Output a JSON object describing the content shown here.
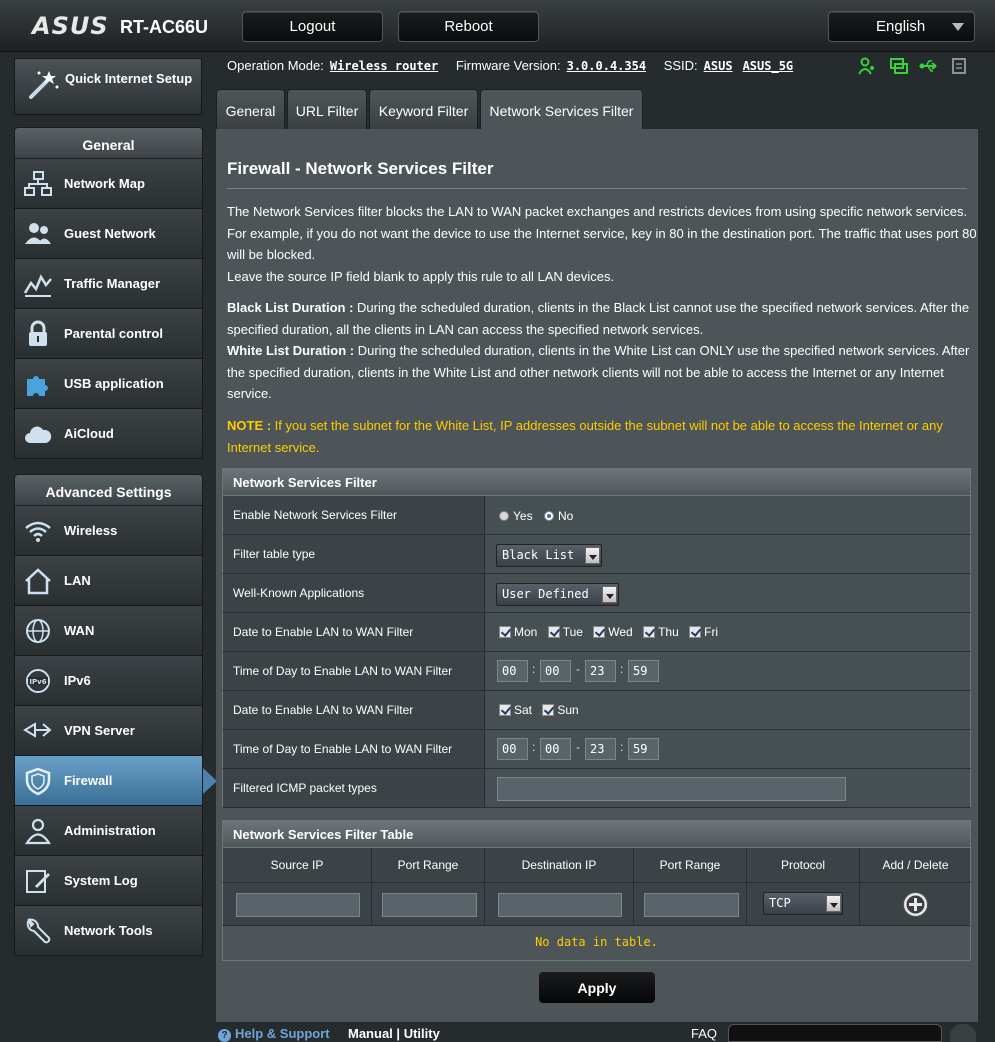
{
  "header": {
    "brand": "ASUS",
    "model": "RT-AC66U",
    "logout_label": "Logout",
    "reboot_label": "Reboot",
    "language": "English"
  },
  "status": {
    "operation_mode_label": "Operation Mode:",
    "operation_mode_value": "Wireless router",
    "firmware_label": "Firmware Version:",
    "firmware_value": "3.0.0.4.354",
    "ssid_label": "SSID:",
    "ssid_1": "ASUS",
    "ssid_2": "ASUS_5G",
    "icons": [
      "clients-icon",
      "network-status-icon",
      "usb-icon",
      "printer-icon"
    ],
    "icon_color": "#39d139"
  },
  "sidebar": {
    "qis_label": "Quick Internet Setup",
    "general_title": "General",
    "general_items": [
      {
        "label": "Network Map",
        "icon": "network-map-icon"
      },
      {
        "label": "Guest Network",
        "icon": "guest-network-icon"
      },
      {
        "label": "Traffic Manager",
        "icon": "traffic-manager-icon"
      },
      {
        "label": "Parental control",
        "icon": "lock-icon"
      },
      {
        "label": "USB application",
        "icon": "puzzle-icon"
      },
      {
        "label": "AiCloud",
        "icon": "cloud-icon"
      }
    ],
    "advanced_title": "Advanced Settings",
    "advanced_items": [
      {
        "label": "Wireless",
        "icon": "wifi-icon"
      },
      {
        "label": "LAN",
        "icon": "home-icon"
      },
      {
        "label": "WAN",
        "icon": "globe-icon"
      },
      {
        "label": "IPv6",
        "icon": "ipv6-icon"
      },
      {
        "label": "VPN Server",
        "icon": "vpn-icon"
      },
      {
        "label": "Firewall",
        "icon": "shield-icon"
      },
      {
        "label": "Administration",
        "icon": "admin-user-icon"
      },
      {
        "label": "System Log",
        "icon": "system-log-icon"
      },
      {
        "label": "Network Tools",
        "icon": "tools-icon"
      }
    ],
    "active_item": "Firewall"
  },
  "tabs": [
    "General",
    "URL Filter",
    "Keyword Filter",
    "Network Services Filter"
  ],
  "active_tab": "Network Services Filter",
  "page": {
    "title": "Firewall - Network Services Filter",
    "desc_1": "The Network Services filter blocks the LAN to WAN packet exchanges and restricts devices from using specific network services. For example, if you do not want the device to use the Internet service, key in 80 in the destination port. The traffic that uses port 80 will be blocked.",
    "desc_2": "Leave the source IP field blank to apply this rule to all LAN devices.",
    "black_list_title": "Black List Duration :",
    "black_list_text": " During the scheduled duration, clients in the Black List cannot use the specified network services. After the specified duration, all the clients in LAN can access the specified network services.",
    "white_list_title": "White List Duration :",
    "white_list_text": " During the scheduled duration, clients in the White List can ONLY use the specified network services. After the specified duration, clients in the White List and other network clients will not be able to access the Internet or any Internet service.",
    "note_title": "NOTE :",
    "note_text": " If you set the subnet for the White List, IP addresses outside the subnet will not be able to access the Internet or any Internet service."
  },
  "filter_section": {
    "title": "Network Services Filter",
    "enable_label": "Enable Network Services Filter",
    "yes_label": "Yes",
    "no_label": "No",
    "enabled": false,
    "table_type_label": "Filter table type",
    "table_type_value": "Black List",
    "well_known_label": "Well-Known Applications",
    "well_known_value": "User Defined",
    "weekday_date_label": "Date to Enable LAN to WAN Filter",
    "weekdays": [
      "Mon",
      "Tue",
      "Wed",
      "Thu",
      "Fri"
    ],
    "weekday_time_label": "Time of Day to Enable LAN to WAN Filter",
    "weekday_time": {
      "start_h": "00",
      "start_m": "00",
      "end_h": "23",
      "end_m": "59"
    },
    "weekend_date_label": "Date to Enable LAN to WAN Filter",
    "weekend": [
      "Sat",
      "Sun"
    ],
    "weekend_time_label": "Time of Day to Enable LAN to WAN Filter",
    "weekend_time": {
      "start_h": "00",
      "start_m": "00",
      "end_h": "23",
      "end_m": "59"
    },
    "icmp_label": "Filtered ICMP packet types",
    "icmp_value": ""
  },
  "filter_table": {
    "title": "Network Services Filter Table",
    "columns": [
      "Source IP",
      "Port Range",
      "Destination IP",
      "Port Range",
      "Protocol",
      "Add / Delete"
    ],
    "protocol_value": "TCP",
    "empty_text": "No data in table."
  },
  "apply_label": "Apply",
  "footer": {
    "help_label": "Help & Support",
    "manual_label": "Manual",
    "divider": "|",
    "utility_label": "Utility",
    "faq_label": "FAQ"
  }
}
